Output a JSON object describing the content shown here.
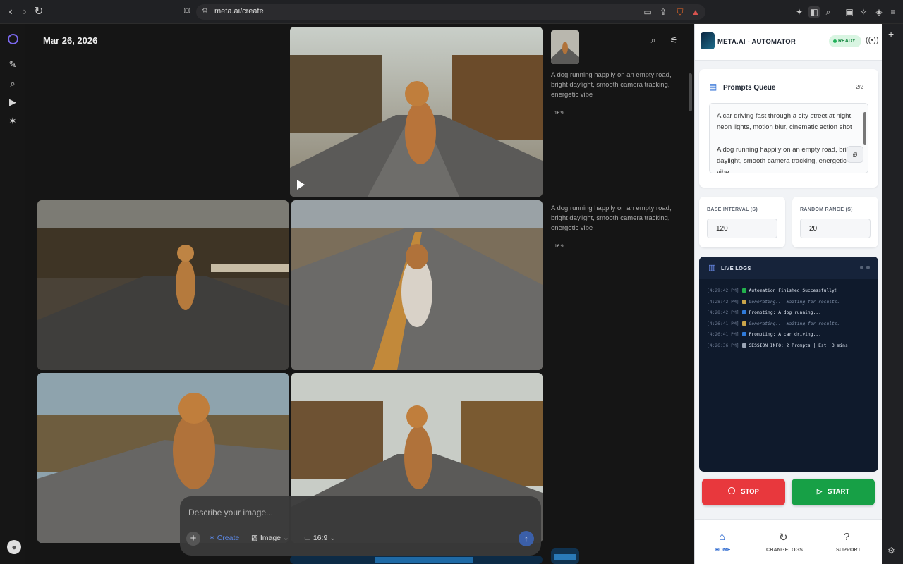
{
  "browser": {
    "url": "meta.ai/create"
  },
  "feed": {
    "date": "Mar 26, 2026",
    "items": [
      {
        "caption": "A dog running happily on an empty road, bright daylight, smooth camera tracking, energetic vibe",
        "ratio": "16:9"
      },
      {
        "caption": "A dog running happily on an empty road, bright daylight, smooth camera tracking, energetic vibe",
        "ratio": "16:9"
      }
    ]
  },
  "composer": {
    "placeholder": "Describe your image...",
    "create_label": "Create",
    "media_label": "Image",
    "ratio_label": "16:9"
  },
  "panel": {
    "title": "META.AI - AUTOMATOR",
    "status": "READY",
    "queue": {
      "title": "Prompts Queue",
      "count": "2/2",
      "text": "A car driving fast through a city street at night, neon lights, motion blur, cinematic action shot\n\nA dog running happily on an empty road, bright daylight, smooth camera tracking, energetic vibe"
    },
    "base_interval": {
      "label": "BASE INTERVAL (S)",
      "value": "120"
    },
    "random_range": {
      "label": "RANDOM RANGE (S)",
      "value": "20"
    },
    "logs": {
      "title": "LIVE LOGS",
      "lines": [
        {
          "time": "[4:29:42 PM]",
          "text": "Automation Finished Successfully!",
          "icon_color": "#22b14c",
          "style": "normal"
        },
        {
          "time": "[4:28:42 PM]",
          "text": "Generating... Waiting for results.",
          "icon_color": "#c9a44a",
          "style": "muted"
        },
        {
          "time": "[4:28:42 PM]",
          "text": "Prompting: A dog running...",
          "icon_color": "#2f7ad9",
          "style": "normal"
        },
        {
          "time": "[4:26:41 PM]",
          "text": "Generating... Waiting for results.",
          "icon_color": "#c9a44a",
          "style": "muted"
        },
        {
          "time": "[4:26:41 PM]",
          "text": "Prompting: A car driving...",
          "icon_color": "#2f7ad9",
          "style": "normal"
        },
        {
          "time": "[4:26:36 PM]",
          "text": "SESSION INFO: 2 Prompts | Est: 3 mins",
          "icon_color": "#9aa4b4",
          "style": "normal"
        }
      ]
    },
    "stop_label": "STOP",
    "start_label": "START",
    "nav": {
      "home": "HOME",
      "changelogs": "CHANGELOGS",
      "support": "SUPPORT"
    }
  },
  "colors": {
    "stop": "#e8383d",
    "start": "#17a046",
    "home_active": "#1f5fcc"
  }
}
